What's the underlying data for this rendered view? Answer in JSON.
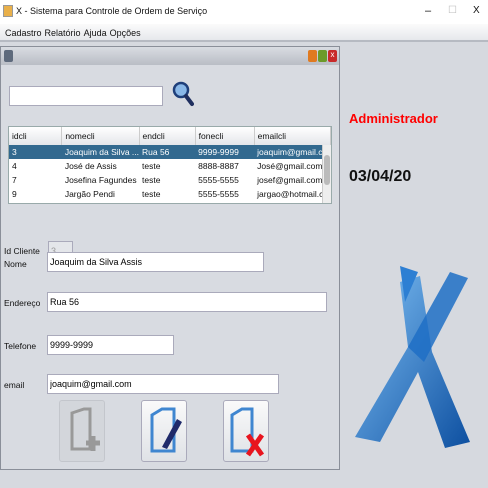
{
  "window": {
    "title": "X - Sistema para Controle de Ordem de Serviço",
    "minimize": "–",
    "maximize": "☐",
    "close": "X"
  },
  "menu": [
    "Cadastro",
    "Relatório",
    "Ajuda",
    "Opções"
  ],
  "search": {
    "value": ""
  },
  "table": {
    "headers": [
      "idcli",
      "nomecli",
      "endcli",
      "fonecli",
      "emailcli"
    ],
    "rows": [
      [
        "3",
        "Joaquim da Silva ...",
        "Rua 56",
        "9999-9999",
        "joaquim@gmail.c..."
      ],
      [
        "4",
        "José de Assis",
        "teste",
        "8888-8887",
        "José@gmail.com"
      ],
      [
        "7",
        "Josefina Fagundes",
        "teste",
        "5555-5555",
        "josef@gmail.com"
      ],
      [
        "9",
        "Jargão Pendi",
        "teste",
        "5555-5555",
        "jargao@hotmail.c..."
      ]
    ],
    "selected_row": 0
  },
  "form": {
    "id_label": "Id Cliente",
    "id_value": "3",
    "nome_label": "Nome",
    "nome_value": "Joaquim da Silva Assis",
    "endereco_label": "Endereço",
    "endereco_value": "Rua 56",
    "telefone_label": "Telefone",
    "telefone_value": "9999-9999",
    "email_label": "email",
    "email_value": "joaquim@gmail.com"
  },
  "user": "Administrador",
  "date": "03/04/20",
  "colors": {
    "user": "#ff0000",
    "selection": "#32698f"
  }
}
